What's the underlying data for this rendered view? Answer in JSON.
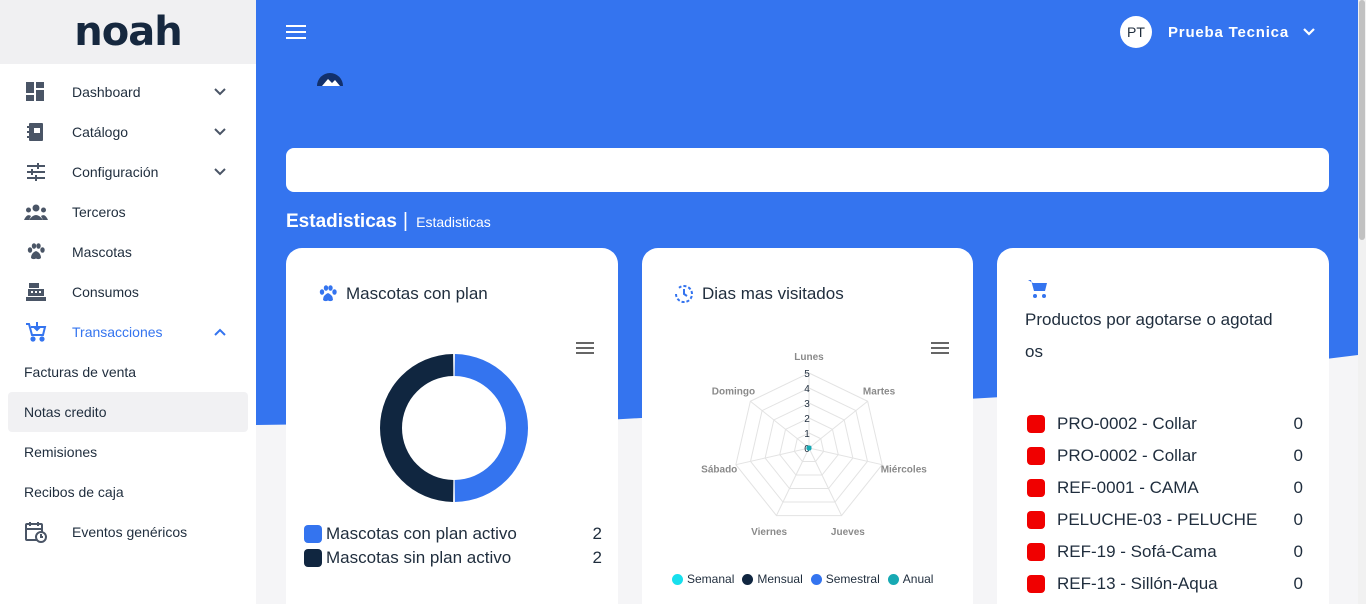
{
  "app": {
    "logo_text": "noah"
  },
  "colors": {
    "primary": "#3474ef",
    "dark": "#102640",
    "danger": "#f00000",
    "cyan": "#17dfed",
    "teal": "#17a9b3"
  },
  "sidebar": {
    "items": [
      {
        "label": "Dashboard",
        "icon": "dashboard-icon",
        "has_chevron": true
      },
      {
        "label": "Catálogo",
        "icon": "catalog-icon",
        "has_chevron": true
      },
      {
        "label": "Configuración",
        "icon": "sliders-icon",
        "has_chevron": true
      },
      {
        "label": "Terceros",
        "icon": "people-icon",
        "has_chevron": false
      },
      {
        "label": "Mascotas",
        "icon": "paw-icon",
        "has_chevron": false
      },
      {
        "label": "Consumos",
        "icon": "cash-register-icon",
        "has_chevron": false
      },
      {
        "label": "Transacciones",
        "icon": "cart-icon",
        "has_chevron": true,
        "expanded": true
      }
    ],
    "sub_items": [
      "Facturas de venta",
      "Notas credito",
      "Remisiones",
      "Recibos de caja"
    ],
    "selected_sub_item": "Notas credito",
    "last_item": {
      "label": "Eventos genéricos",
      "icon": "calendar-clock-icon"
    }
  },
  "header": {
    "user_initials": "PT",
    "user_name": "Prueba Tecnica"
  },
  "breadcrumb": {
    "title": "Estadisticas",
    "separator": "|",
    "sub": "Estadisticas"
  },
  "cards": {
    "pets": {
      "title": "Mascotas con plan",
      "legend": [
        {
          "label": "Mascotas con plan activo",
          "value": "2",
          "color": "#3474ef"
        },
        {
          "label": "Mascotas sin plan activo",
          "value": "2",
          "color": "#102640"
        }
      ]
    },
    "days": {
      "title": "Dias mas visitados",
      "axes": [
        "Lunes",
        "Martes",
        "Miércoles",
        "Jueves",
        "Viernes",
        "Sábado",
        "Domingo"
      ],
      "ticks": [
        "0",
        "1",
        "2",
        "3",
        "4",
        "5"
      ],
      "legend": [
        {
          "label": "Semanal",
          "color": "#17dfed"
        },
        {
          "label": "Mensual",
          "color": "#102640"
        },
        {
          "label": "Semestral",
          "color": "#3474ef"
        },
        {
          "label": "Anual",
          "color": "#17a9b3"
        }
      ]
    },
    "products": {
      "title": "Productos por agotarse o agotados",
      "title_line1": "Productos por agotarse o agotad",
      "title_line2": "os",
      "items": [
        {
          "label": "PRO-0002 - Collar",
          "value": "0"
        },
        {
          "label": "PRO-0002 - Collar",
          "value": "0"
        },
        {
          "label": "REF-0001 - CAMA",
          "value": "0"
        },
        {
          "label": "PELUCHE-03 - PELUCHE",
          "value": "0"
        },
        {
          "label": "REF-19 - Sofá-Cama",
          "value": "0"
        },
        {
          "label": "REF-13 - Sillón-Aqua",
          "value": "0"
        }
      ]
    }
  },
  "chart_data": [
    {
      "type": "pie",
      "title": "Mascotas con plan",
      "categories": [
        "Mascotas con plan activo",
        "Mascotas sin plan activo"
      ],
      "values": [
        2,
        2
      ]
    },
    {
      "type": "radar",
      "title": "Dias mas visitados",
      "categories": [
        "Lunes",
        "Martes",
        "Miércoles",
        "Jueves",
        "Viernes",
        "Sábado",
        "Domingo"
      ],
      "ylim": [
        0,
        5
      ],
      "series": [
        {
          "name": "Semanal",
          "values": [
            0,
            0,
            0,
            0,
            0,
            0,
            0
          ]
        },
        {
          "name": "Mensual",
          "values": [
            0,
            0,
            0,
            0,
            0,
            0,
            0
          ]
        },
        {
          "name": "Semestral",
          "values": [
            0,
            0,
            0,
            0,
            0,
            0,
            0
          ]
        },
        {
          "name": "Anual",
          "values": [
            0,
            0,
            0,
            0,
            0,
            0,
            0
          ]
        }
      ],
      "legend": "bottom"
    }
  ]
}
